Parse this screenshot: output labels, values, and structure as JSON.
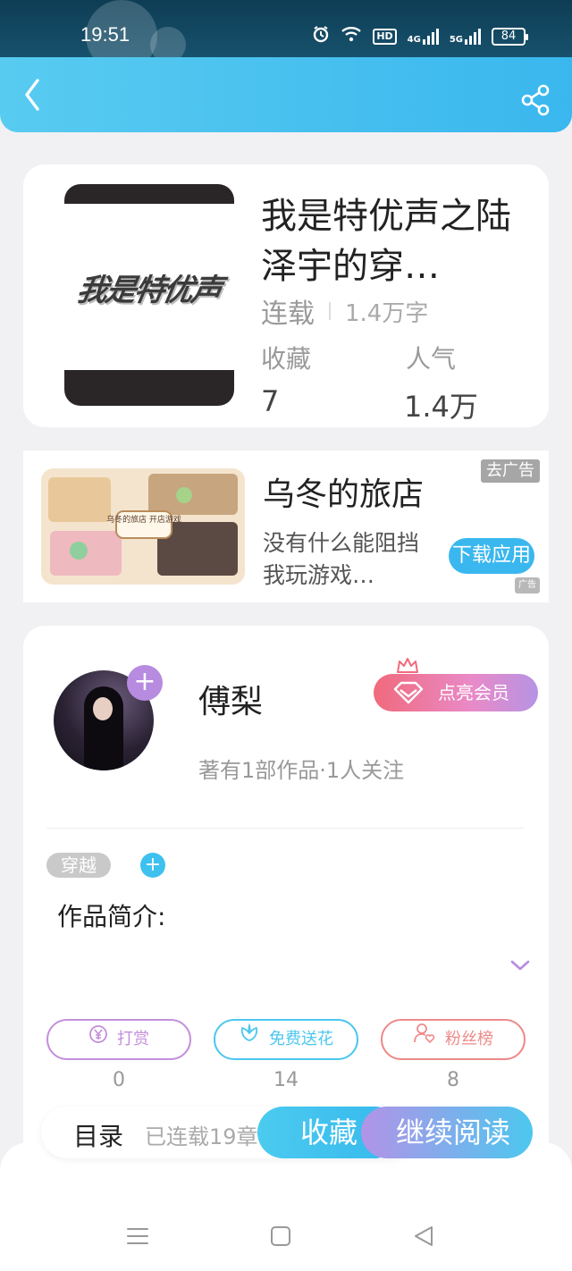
{
  "status_bar": {
    "time": "19:51",
    "network_hd": "HD",
    "network_4g": "4G",
    "network_5g": "5G",
    "battery": "84"
  },
  "header": {
    "back_icon": "chevron-left-icon",
    "share_icon": "share-icon"
  },
  "book": {
    "title": "我是特优声之陆泽宇的穿…",
    "status": "连载",
    "word_count": "1.4万字",
    "cover_text": "我是特优声",
    "stats": [
      {
        "label": "收藏",
        "value": "7"
      },
      {
        "label": "人气",
        "value": "1.4万"
      }
    ]
  },
  "ad": {
    "title": "乌冬的旅店",
    "description": "没有什么能阻挡我玩游戏…",
    "close_label": "去广告",
    "download_label": "下载应用",
    "tag": "广告",
    "image_text": "乌冬的旅店 开店游戏"
  },
  "author": {
    "name": "傅梨",
    "subtitle": "著有1部作品·1人关注",
    "vip_label": "点亮会员",
    "genre_tag": "穿越",
    "intro_label": "作品简介:"
  },
  "actions": [
    {
      "label": "打赏",
      "count": "0",
      "color": "#c48fdc",
      "icon": "yen-icon"
    },
    {
      "label": "免费送花",
      "count": "14",
      "color": "#4cc7ef",
      "icon": "flower-icon"
    },
    {
      "label": "粉丝榜",
      "count": "8",
      "color": "#ee8a8a",
      "icon": "fan-icon"
    }
  ],
  "bottom_bar": {
    "toc_label": "目录",
    "toc_sub": "已连载19章",
    "favorite_label": "收藏",
    "read_label": "继续阅读"
  },
  "colors": {
    "accent_blue": "#3ab7ee",
    "accent_purple": "#b78be0",
    "vip_pink": "#f06a7c"
  }
}
